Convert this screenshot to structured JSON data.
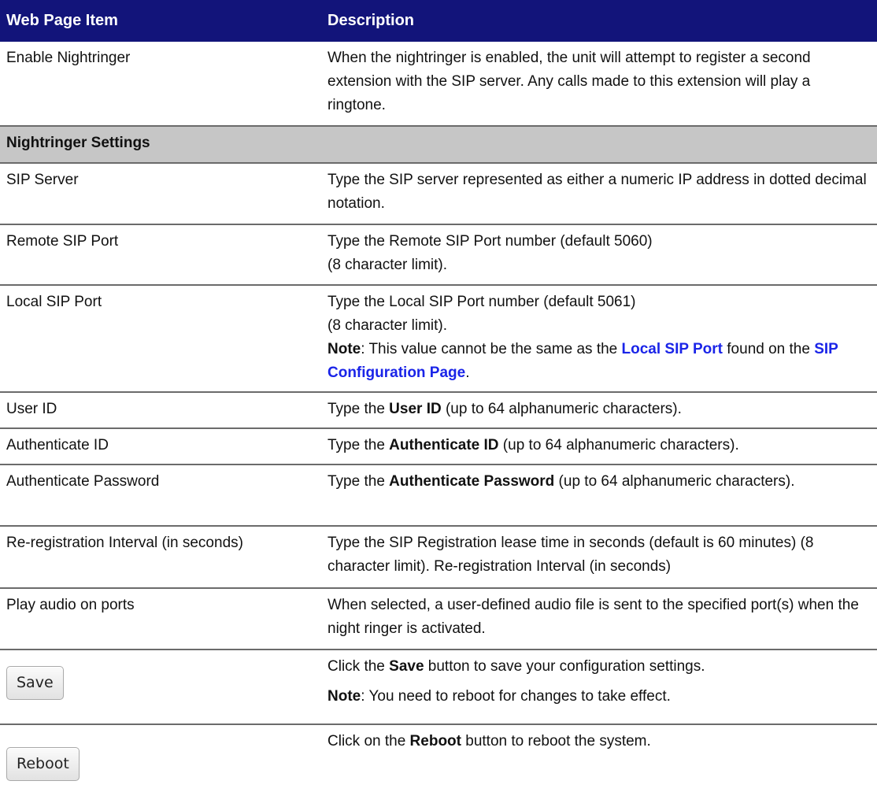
{
  "header": {
    "col1": "Web Page Item",
    "col2": "Description"
  },
  "rows": {
    "enable": {
      "item": "Enable Nightringer",
      "desc": "When the nightringer is enabled, the unit will attempt to register a second extension with the SIP server. Any calls made to this extension will play a ringtone."
    },
    "section": "Nightringer Settings",
    "sip_server": {
      "item": "SIP Server",
      "desc": "Type the SIP server represented as either a numeric IP address in dotted decimal notation."
    },
    "remote_port": {
      "item": "Remote SIP Port",
      "desc1": "Type the Remote SIP Port number (default 5060)",
      "desc2": "(8 character limit)."
    },
    "local_port": {
      "item": "Local SIP Port",
      "desc1": "Type the Local SIP Port number (default 5061)",
      "desc2": "(8 character limit).",
      "note_label": "Note",
      "note_text1": ": This value cannot be the same as the ",
      "note_link1": "Local SIP Port",
      "note_text2": " found on the ",
      "note_link2": "SIP Configuration Page",
      "note_text3": "."
    },
    "user_id": {
      "item": "User ID",
      "pre": "Type the ",
      "bold": "User ID",
      "post": " (up to 64 alphanumeric characters)."
    },
    "auth_id": {
      "item": "Authenticate ID",
      "pre": "Type the ",
      "bold": "Authenticate ID",
      "post": " (up to 64 alphanumeric characters)."
    },
    "auth_pw": {
      "item": "Authenticate Password",
      "pre": "Type the ",
      "bold": "Authenticate Password",
      "post": " (up to 64 alphanumeric characters)."
    },
    "rereg": {
      "item": "Re-registration Interval (in seconds)",
      "desc": "Type the SIP Registration lease time in seconds (default is 60 minutes) (8 character limit). Re-registration Interval (in seconds)"
    },
    "play_audio": {
      "item": "Play audio on ports",
      "desc": "When selected, a user-defined audio file is sent to the specified port(s) when the night ringer is activated."
    },
    "save": {
      "button": "Save",
      "pre": "Click the ",
      "bold": "Save",
      "post": " button to save your configuration settings.",
      "note_label": "Note",
      "note_text": ": You need to reboot for changes to take effect."
    },
    "reboot": {
      "button": "Reboot",
      "pre": "Click on the ",
      "bold": "Reboot",
      "post": " button to reboot the system."
    }
  }
}
